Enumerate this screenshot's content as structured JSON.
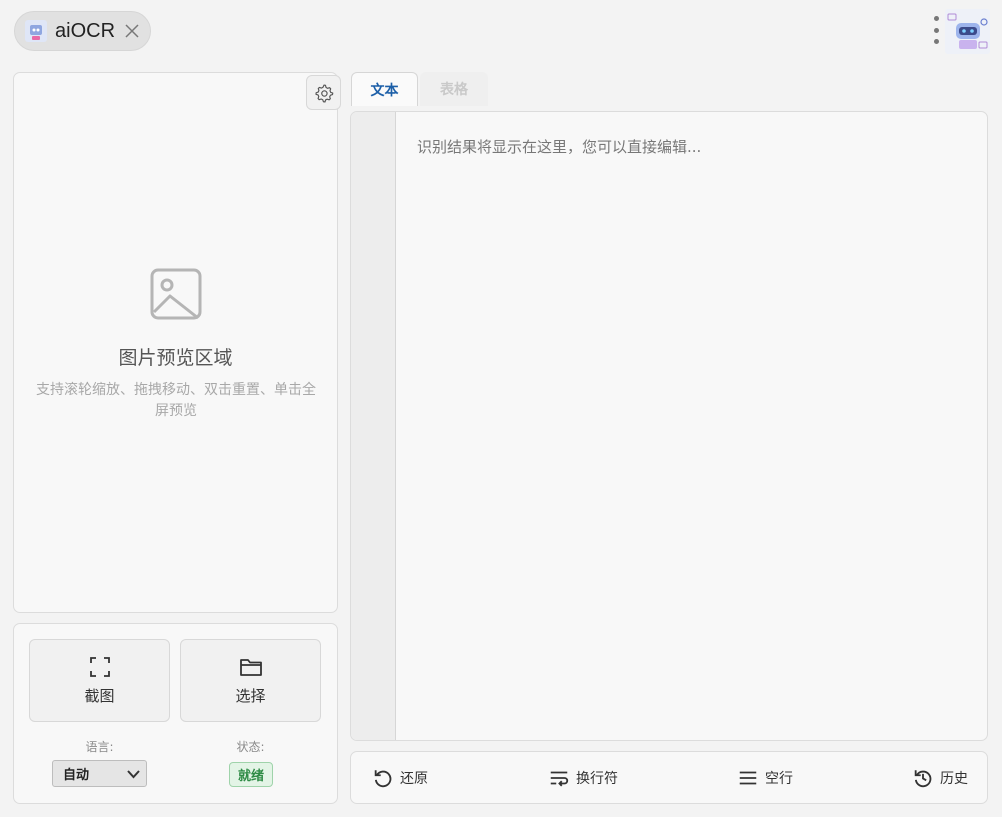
{
  "app": {
    "name": "aiOCR"
  },
  "preview": {
    "title": "图片预览区域",
    "hint": "支持滚轮缩放、拖拽移动、双击重置、单击全屏预览"
  },
  "controls": {
    "capture_label": "截图",
    "select_label": "选择",
    "language_label": "语言:",
    "language_value": "自动",
    "status_label": "状态:",
    "status_value": "就绪"
  },
  "tabs": [
    {
      "label": "文本",
      "active": true
    },
    {
      "label": "表格",
      "active": false
    }
  ],
  "editor": {
    "placeholder": "识别结果将显示在这里，您可以直接编辑..."
  },
  "bottombar": {
    "restore_label": "还原",
    "newline_label": "换行符",
    "blank_label": "空行",
    "history_label": "历史"
  },
  "colors": {
    "accent": "#1c5fa8",
    "status": "#2e8b45",
    "status_bg": "#e3f4e6"
  },
  "icons": [
    "app-logo-icon",
    "close-icon",
    "more-vert-icon",
    "robot-avatar-icon",
    "gear-icon",
    "image-icon",
    "fullscreen-icon",
    "folder-icon",
    "chevron-down-icon",
    "undo-icon",
    "wrap-text-icon",
    "menu-lines-icon",
    "history-icon"
  ]
}
